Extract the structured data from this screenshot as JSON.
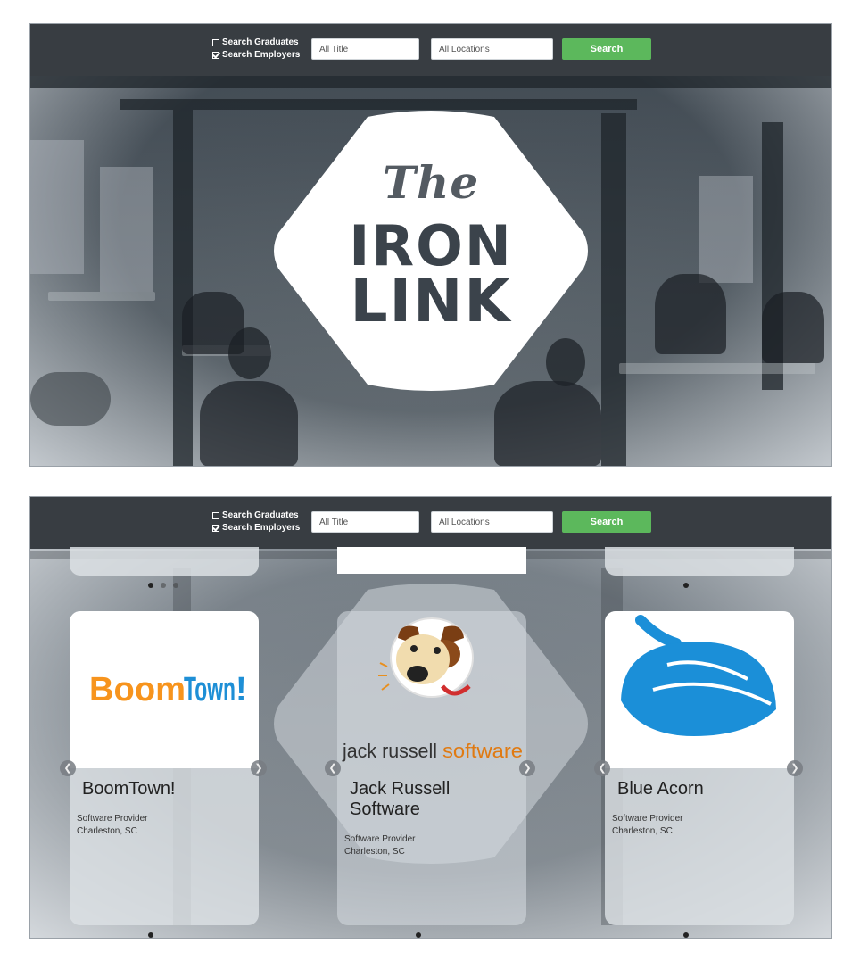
{
  "search": {
    "opt_graduates": "Search Graduates",
    "opt_employers": "Search Employers",
    "graduates_checked": false,
    "employers_checked": true,
    "title_value": "All Title",
    "location_value": "All Locations",
    "button_label": "Search"
  },
  "logo": {
    "line1": "The",
    "line2": "IRON",
    "line3": "LINK"
  },
  "cards": [
    {
      "name": "BoomTown!",
      "logo_text": "BoomTown!",
      "category": "Software Provider",
      "location": "Charleston, SC"
    },
    {
      "name_line1": "Jack Russell",
      "name_line2": "Software",
      "logo_text": "jack russell software",
      "category": "Software Provider",
      "location": "Charleston, SC"
    },
    {
      "name": "Blue Acorn",
      "category": "Software Provider",
      "location": "Charleston, SC"
    }
  ],
  "colors": {
    "header_bg": "#383d42",
    "search_button": "#5cb85c",
    "boomtown_orange": "#f7941d",
    "boomtown_blue": "#1e8fd6",
    "acorn_blue": "#1b8fd8",
    "jrs_brown": "#8b4a1a"
  },
  "icons": {
    "prev": "chevron-left-icon",
    "next": "chevron-right-icon"
  }
}
